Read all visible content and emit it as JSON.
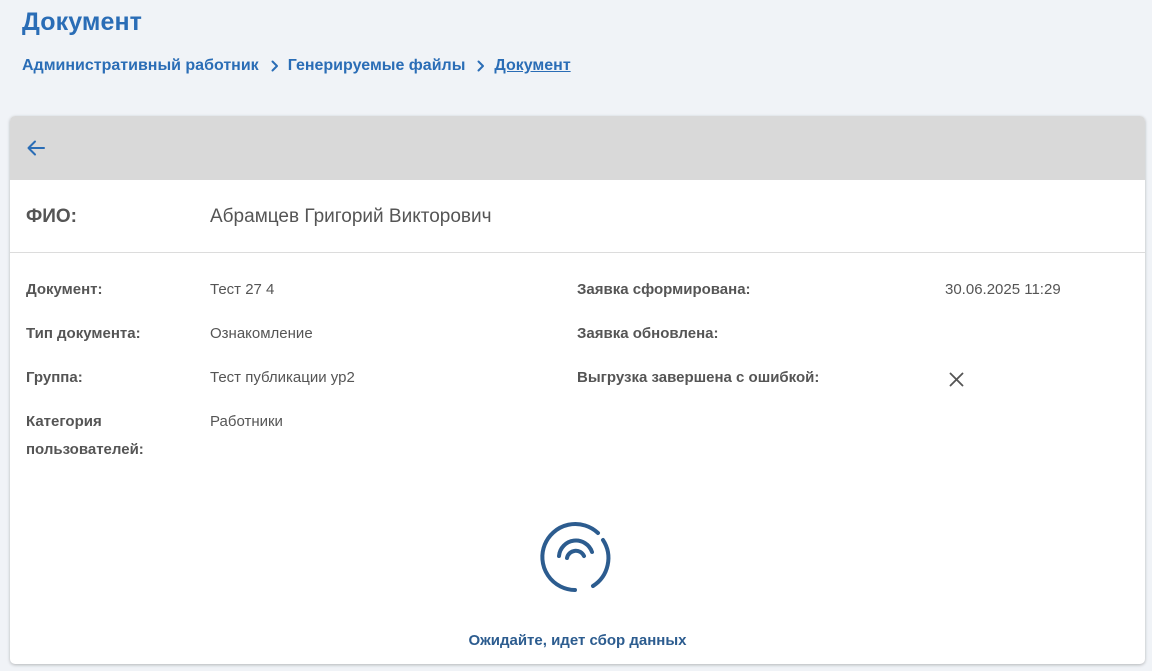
{
  "page": {
    "title": "Документ"
  },
  "breadcrumb": {
    "items": [
      "Административный работник",
      "Генерируемые файлы",
      "Документ"
    ]
  },
  "card": {
    "fio_label": "ФИО:",
    "fio_value": "Абрамцев Григорий Викторович",
    "fields_left": [
      {
        "label": "Документ:",
        "value": "Тест 27 4"
      },
      {
        "label": "Тип документа:",
        "value": "Ознакомление"
      },
      {
        "label": "Группа:",
        "value": "Тест публикации ур2"
      },
      {
        "label_line1": "Категория",
        "label_line2": "пользователей:",
        "value": "Работники"
      }
    ],
    "fields_right": [
      {
        "label": "Заявка сформирована:",
        "value": "30.06.2025 11:29"
      },
      {
        "label": "Заявка обновлена:",
        "value": ""
      },
      {
        "label": "Выгрузка завершена с ошибкой:",
        "icon": "close-icon"
      }
    ],
    "loading_text": "Ожидайте, идет сбор данных"
  },
  "colors": {
    "accent": "#2a6db6",
    "header_bg": "#d9d9d9",
    "page_bg": "#f0f3f7",
    "loader": "#2c5c8f"
  }
}
